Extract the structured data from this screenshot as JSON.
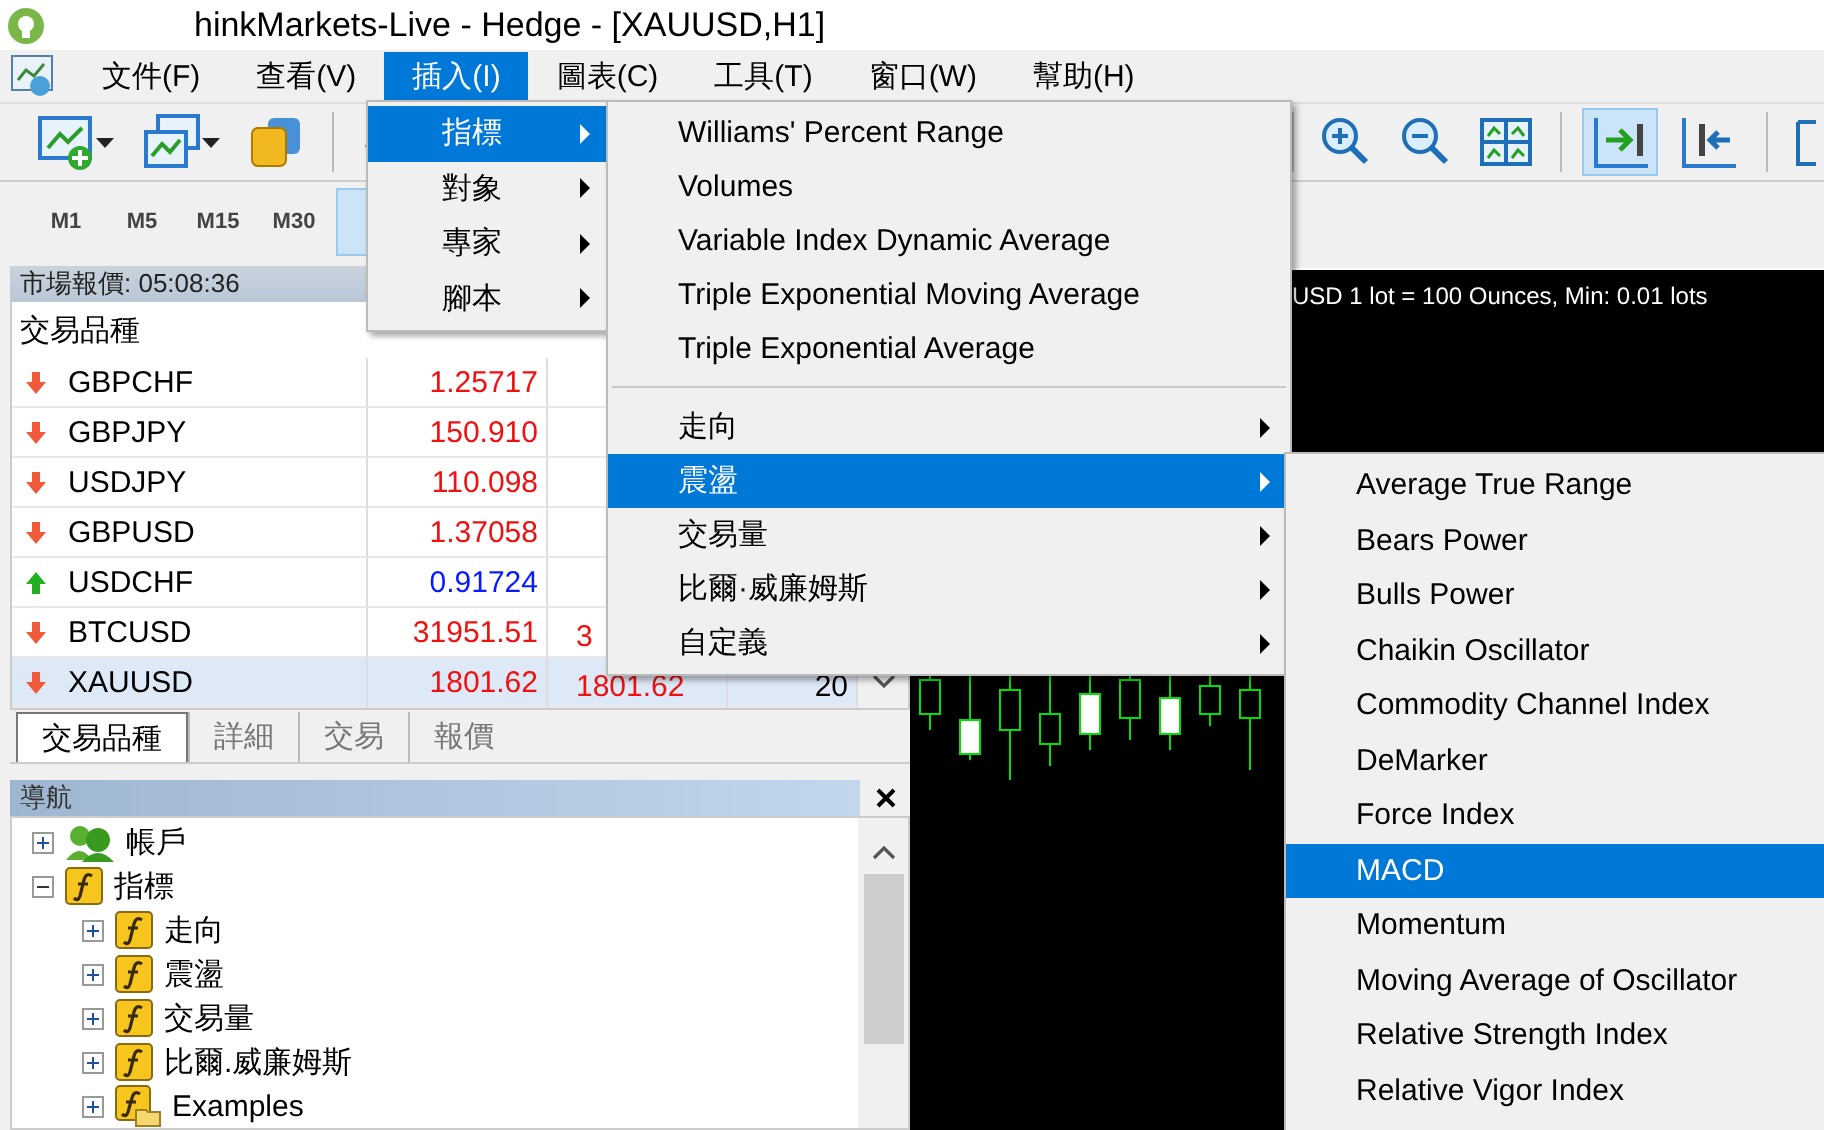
{
  "window": {
    "title": "hinkMarkets-Live - Hedge - [XAUUSD,H1]"
  },
  "menu_bar": [
    {
      "label": "文件(F)",
      "selected": false
    },
    {
      "label": "查看(V)",
      "selected": false
    },
    {
      "label": "插入(I)",
      "selected": true
    },
    {
      "label": "圖表(C)",
      "selected": false
    },
    {
      "label": "工具(T)",
      "selected": false
    },
    {
      "label": "窗口(W)",
      "selected": false
    },
    {
      "label": "幫助(H)",
      "selected": false
    }
  ],
  "timeframes": [
    {
      "label": "M1",
      "selected": false
    },
    {
      "label": "M5",
      "selected": false
    },
    {
      "label": "M15",
      "selected": false
    },
    {
      "label": "M30",
      "selected": false
    }
  ],
  "market_watch": {
    "title": "市場報價: 05:08:36",
    "columns": [
      "交易品種"
    ],
    "rows": [
      {
        "symbol": "GBPCHF",
        "kind": "down",
        "bid": "1.25717",
        "selected": false
      },
      {
        "symbol": "GBPJPY",
        "kind": "down",
        "bid": "150.910",
        "selected": false
      },
      {
        "symbol": "USDJPY",
        "kind": "down",
        "bid": "110.098",
        "selected": false
      },
      {
        "symbol": "GBPUSD",
        "kind": "down",
        "bid": "1.37058",
        "selected": false
      },
      {
        "symbol": "USDCHF",
        "kind": "up",
        "bid": "0.91724",
        "selected": false
      },
      {
        "symbol": "BTCUSD",
        "kind": "down",
        "bid": "31951.51",
        "ask": "3",
        "selected": false
      },
      {
        "symbol": "XAUUSD",
        "kind": "down",
        "bid": "1801.62",
        "ask": "1801.62",
        "spread": "20",
        "selected": true
      }
    ]
  },
  "tabs": [
    {
      "label": "交易品種",
      "selected": true
    },
    {
      "label": "詳細",
      "selected": false
    },
    {
      "label": "交易",
      "selected": false
    },
    {
      "label": "報價",
      "selected": false
    }
  ],
  "navigator": {
    "title": "導航",
    "tree": [
      {
        "label": "帳戶",
        "kind": "accounts",
        "expanded": false
      },
      {
        "label": "指標",
        "kind": "indicators",
        "expanded": true,
        "children": [
          {
            "label": "走向",
            "kind": "indicators",
            "expanded": false
          },
          {
            "label": "震盪",
            "kind": "indicators",
            "expanded": false
          },
          {
            "label": "交易量",
            "kind": "indicators",
            "expanded": false
          },
          {
            "label": "比爾.威廉姆斯",
            "kind": "indicators",
            "expanded": false
          },
          {
            "label": "Examples",
            "kind": "folder",
            "expanded": false
          }
        ]
      }
    ]
  },
  "chart": {
    "info": "USD 1 lot = 100 Ounces, Min: 0.01 lots"
  },
  "insert_menu": [
    {
      "label": "指標",
      "selected": true
    },
    {
      "label": "對象",
      "selected": false
    },
    {
      "label": "專家",
      "selected": false
    },
    {
      "label": "腳本",
      "selected": false
    }
  ],
  "indicators_menu": {
    "indicators": [
      {
        "label": "Williams' Percent Range",
        "selected": false
      },
      {
        "label": "Volumes",
        "selected": false
      },
      {
        "label": "Variable Index Dynamic Average",
        "selected": false
      },
      {
        "label": "Triple Exponential Moving Average",
        "selected": false
      },
      {
        "label": "Triple Exponential Average",
        "selected": false
      }
    ],
    "groups": [
      {
        "label": "走向",
        "selected": false
      },
      {
        "label": "震盪",
        "selected": true
      },
      {
        "label": "交易量",
        "selected": false
      },
      {
        "label": "比爾·威廉姆斯",
        "selected": false
      },
      {
        "label": "自定義",
        "selected": false
      }
    ]
  },
  "oscillators_menu": [
    {
      "label": "Average True Range",
      "selected": false
    },
    {
      "label": "Bears Power",
      "selected": false
    },
    {
      "label": "Bulls Power",
      "selected": false
    },
    {
      "label": "Chaikin Oscillator",
      "selected": false
    },
    {
      "label": "Commodity Channel Index",
      "selected": false
    },
    {
      "label": "DeMarker",
      "selected": false
    },
    {
      "label": "Force Index",
      "selected": false
    },
    {
      "label": "MACD",
      "selected": true
    },
    {
      "label": "Momentum",
      "selected": false
    },
    {
      "label": "Moving Average of Oscillator",
      "selected": false
    },
    {
      "label": "Relative Strength Index",
      "selected": false
    },
    {
      "label": "Relative Vigor Index",
      "selected": false
    }
  ]
}
